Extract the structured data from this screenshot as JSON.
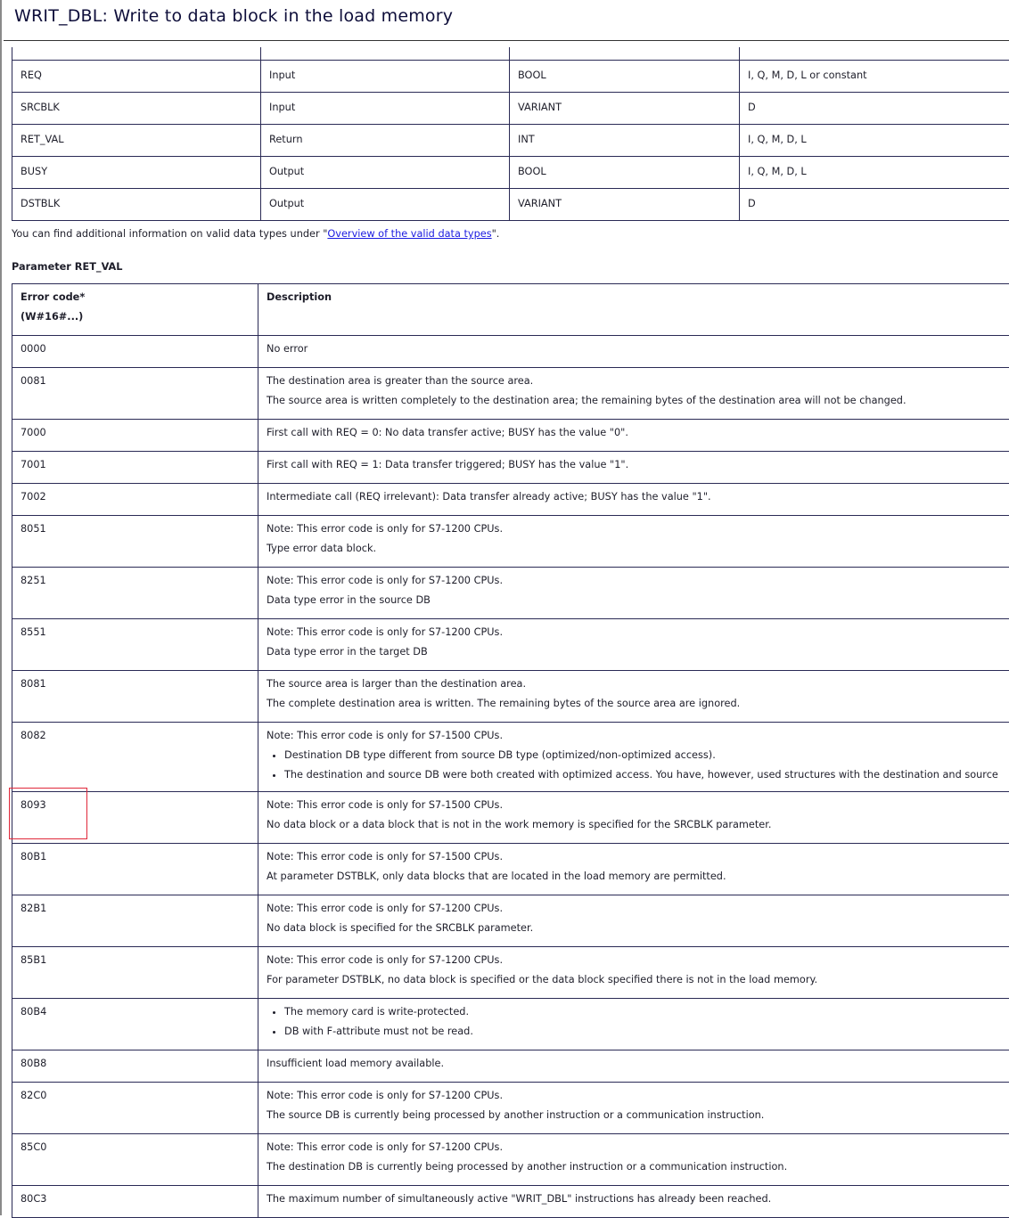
{
  "title": "WRIT_DBL: Write to data block in the load memory",
  "parameters": [
    [
      "REQ",
      "Input",
      "BOOL",
      "I, Q, M, D, L or constant"
    ],
    [
      "SRCBLK",
      "Input",
      "VARIANT",
      "D"
    ],
    [
      "RET_VAL",
      "Return",
      "INT",
      "I, Q, M, D, L"
    ],
    [
      "BUSY",
      "Output",
      "BOOL",
      "I, Q, M, D, L"
    ],
    [
      "DSTBLK",
      "Output",
      "VARIANT",
      "D"
    ]
  ],
  "note": {
    "prefix": "You can find additional information on valid data types under \"",
    "link": "Overview of the valid data types",
    "suffix": "\"."
  },
  "ret_val_heading": "Parameter RET_VAL",
  "error_table": {
    "header": {
      "code_line1": "Error code*",
      "code_line2": "(W#16#...)",
      "description": "Description"
    },
    "rows": [
      {
        "code": "0000",
        "lines": [
          "No error"
        ]
      },
      {
        "code": "0081",
        "lines": [
          "The destination area is greater than the source area.",
          "The source area is written completely to the destination area; the remaining bytes of the destination area will not be changed."
        ]
      },
      {
        "code": "7000",
        "lines": [
          "First call with REQ = 0: No data transfer active; BUSY has the value \"0\"."
        ]
      },
      {
        "code": "7001",
        "lines": [
          "First call with REQ = 1: Data transfer triggered; BUSY has the value \"1\"."
        ]
      },
      {
        "code": "7002",
        "lines": [
          "Intermediate call (REQ irrelevant): Data transfer already active; BUSY has the value \"1\"."
        ]
      },
      {
        "code": "8051",
        "lines": [
          "Note: This error code is only for S7-1200 CPUs.",
          "Type error data block."
        ]
      },
      {
        "code": "8251",
        "lines": [
          "Note: This error code is only for S7-1200 CPUs.",
          "Data type error in the source DB"
        ]
      },
      {
        "code": "8551",
        "lines": [
          "Note: This error code is only for S7-1200 CPUs.",
          "Data type error in the target DB"
        ]
      },
      {
        "code": "8081",
        "lines": [
          "The source area is larger than the destination area.",
          "The complete destination area is written. The remaining bytes of the source area are ignored."
        ]
      },
      {
        "code": "8082",
        "lines": [
          "Note: This error code is only for S7-1500 CPUs."
        ],
        "bullets": [
          "Destination DB type different from source DB type (optimized/non-optimized access).",
          "The destination and source DB were both created with optimized access. You have, however, used structures with the destination and source"
        ]
      },
      {
        "code": "8093",
        "lines": [
          "Note: This error code is only for S7-1500 CPUs.",
          "No data block or a data block that is not in the work memory is specified for the SRCBLK parameter."
        ],
        "highlighted": true
      },
      {
        "code": "80B1",
        "lines": [
          "Note: This error code is only for S7-1500 CPUs.",
          "At parameter DSTBLK, only data blocks that are located in the load memory are permitted."
        ]
      },
      {
        "code": "82B1",
        "lines": [
          "Note: This error code is only for S7-1200 CPUs.",
          "No data block is specified for the SRCBLK parameter."
        ]
      },
      {
        "code": "85B1",
        "lines": [
          "Note: This error code is only for S7-1200 CPUs.",
          "For parameter DSTBLK, no data block is specified or the data block specified there is not in the load memory."
        ]
      },
      {
        "code": "80B4",
        "lines": [],
        "bullets": [
          "The memory card is write-protected.",
          "DB with F-attribute must not be read."
        ]
      },
      {
        "code": "80B8",
        "lines": [
          "Insufficient load memory available."
        ]
      },
      {
        "code": "82C0",
        "lines": [
          "Note: This error code is only for S7-1200 CPUs.",
          "The source DB is currently being processed by another instruction or a communication instruction."
        ]
      },
      {
        "code": "85C0",
        "lines": [
          "Note: This error code is only for S7-1200 CPUs.",
          "The destination DB is currently being processed by another instruction or a communication instruction."
        ]
      },
      {
        "code": "80C3",
        "lines": [
          "The maximum number of simultaneously active \"WRIT_DBL\" instructions has already been reached."
        ]
      }
    ]
  },
  "colors": {
    "highlight": "#e0283a",
    "link": "#1a1ae0",
    "border": "#2a2a55"
  }
}
